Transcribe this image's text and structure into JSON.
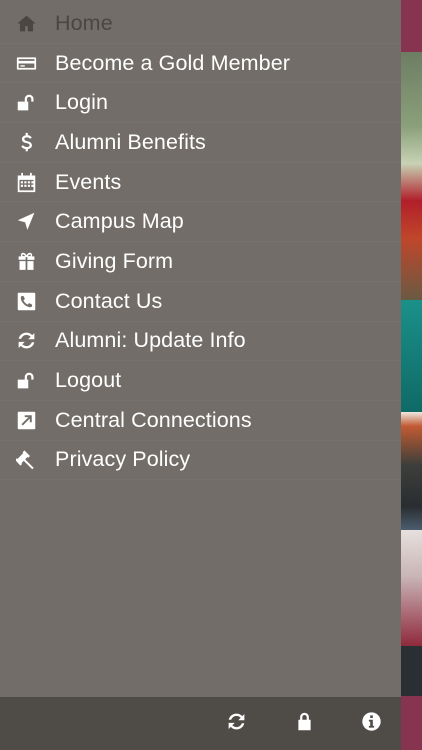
{
  "menu": {
    "items": [
      {
        "label": "Home",
        "icon": "home-icon"
      },
      {
        "label": "Become a Gold Member",
        "icon": "credit-card-icon"
      },
      {
        "label": "Login",
        "icon": "unlock-icon"
      },
      {
        "label": "Alumni Benefits",
        "icon": "dollar-icon"
      },
      {
        "label": "Events",
        "icon": "calendar-icon"
      },
      {
        "label": "Campus Map",
        "icon": "location-arrow-icon"
      },
      {
        "label": "Giving Form",
        "icon": "gift-icon"
      },
      {
        "label": "Contact Us",
        "icon": "phone-icon"
      },
      {
        "label": "Alumni: Update Info",
        "icon": "refresh-icon"
      },
      {
        "label": "Logout",
        "icon": "unlock-icon"
      },
      {
        "label": "Central Connections",
        "icon": "external-link-icon"
      },
      {
        "label": "Privacy Policy",
        "icon": "gavel-icon"
      }
    ]
  },
  "footer": {
    "buttons": [
      {
        "icon": "refresh-icon"
      },
      {
        "icon": "lock-icon"
      },
      {
        "icon": "info-icon"
      }
    ]
  },
  "colors": {
    "drawer": "#726d68",
    "footer": "#4f4b47",
    "active_text": "#4a4643",
    "text": "#ffffff",
    "brand": "#86344f"
  }
}
